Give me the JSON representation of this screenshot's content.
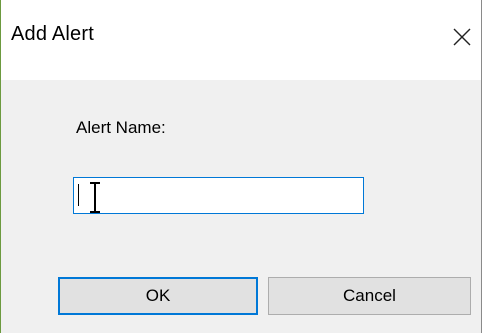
{
  "dialog": {
    "title": "Add Alert",
    "close_icon": "close-icon"
  },
  "form": {
    "label": "Alert Name:",
    "input_value": ""
  },
  "buttons": {
    "ok_label": "OK",
    "cancel_label": "Cancel"
  },
  "colors": {
    "focus_border": "#0078d7",
    "dialog_bg": "#f0f0f0",
    "button_bg": "#e1e1e1"
  }
}
